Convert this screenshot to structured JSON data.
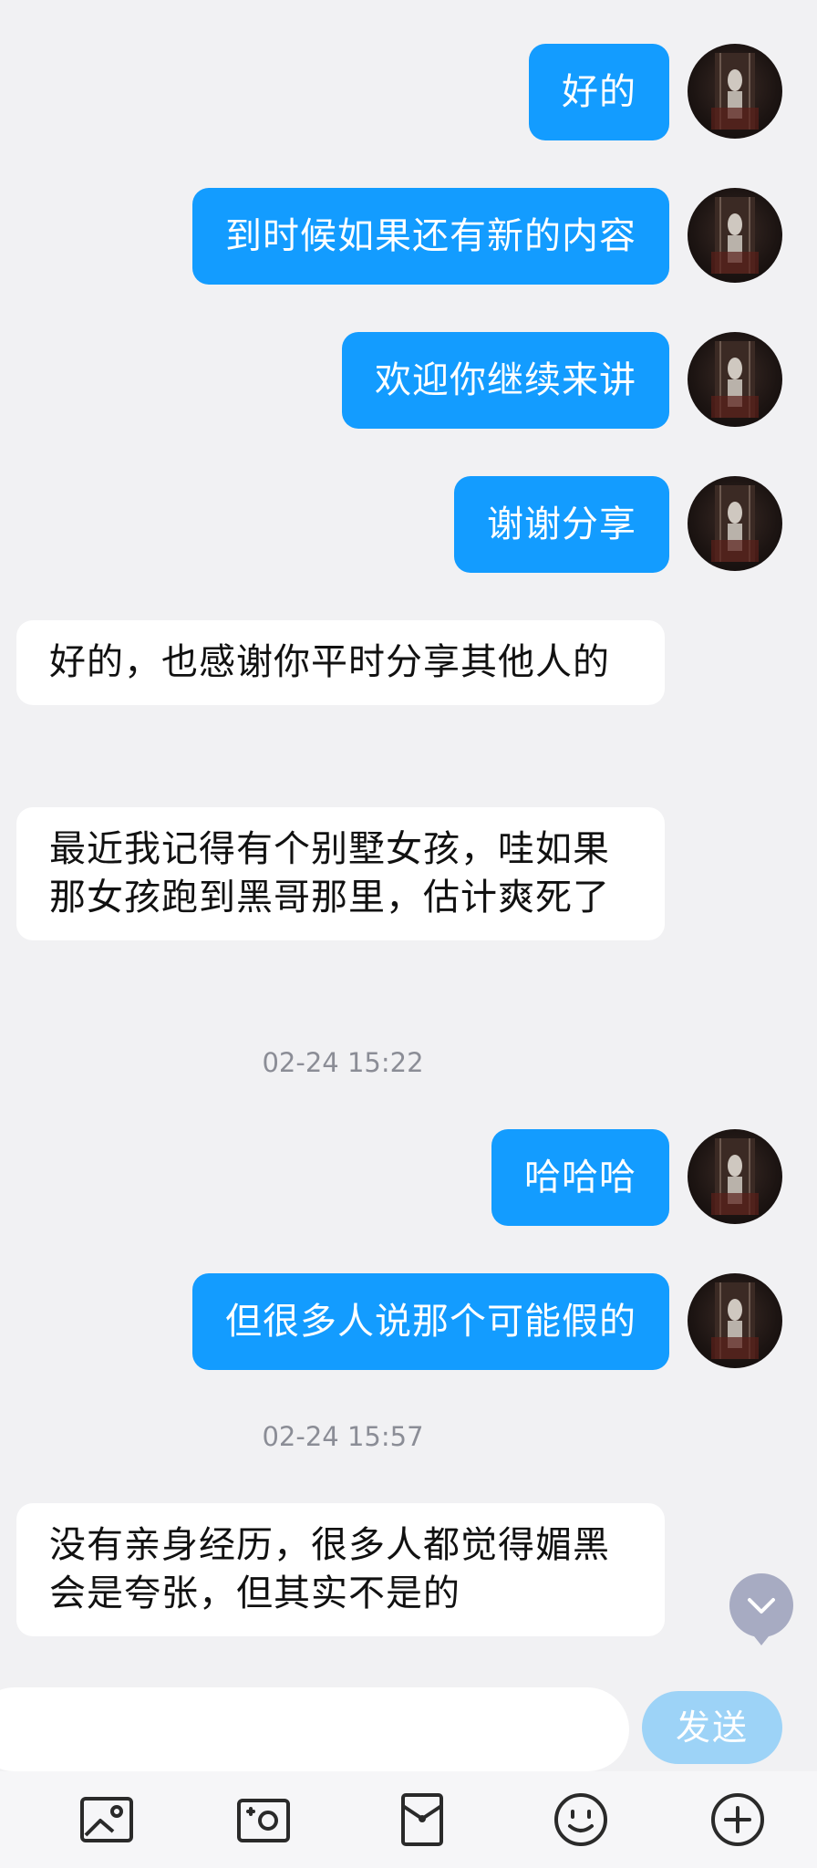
{
  "messages": [
    {
      "side": "out",
      "text": "好的"
    },
    {
      "side": "out",
      "text": "到时候如果还有新的内容"
    },
    {
      "side": "out",
      "text": "欢迎你继续来讲"
    },
    {
      "side": "out",
      "text": "谢谢分享"
    },
    {
      "side": "in",
      "text": "好的，也感谢你平时分享其他人的"
    },
    {
      "side": "in",
      "text": "最近我记得有个别墅女孩，哇如果那女孩跑到黑哥那里，估计爽死了"
    },
    {
      "side": "time",
      "text": "02-24 15:22"
    },
    {
      "side": "out",
      "text": "哈哈哈"
    },
    {
      "side": "out",
      "text": "但很多人说那个可能假的"
    },
    {
      "side": "time",
      "text": "02-24 15:57"
    },
    {
      "side": "in",
      "text": "没有亲身经历，很多人都觉得媚黑会是夸张，但其实不是的"
    }
  ],
  "input": {
    "value": "",
    "send_label": "发送"
  },
  "toolbar": [
    "image-icon",
    "camera-icon",
    "red-packet-icon",
    "emoji-icon",
    "plus-icon"
  ],
  "colors": {
    "outgoing_bubble": "#139cff",
    "send_button": "#9dd3f7",
    "background": "#f1f1f3"
  }
}
